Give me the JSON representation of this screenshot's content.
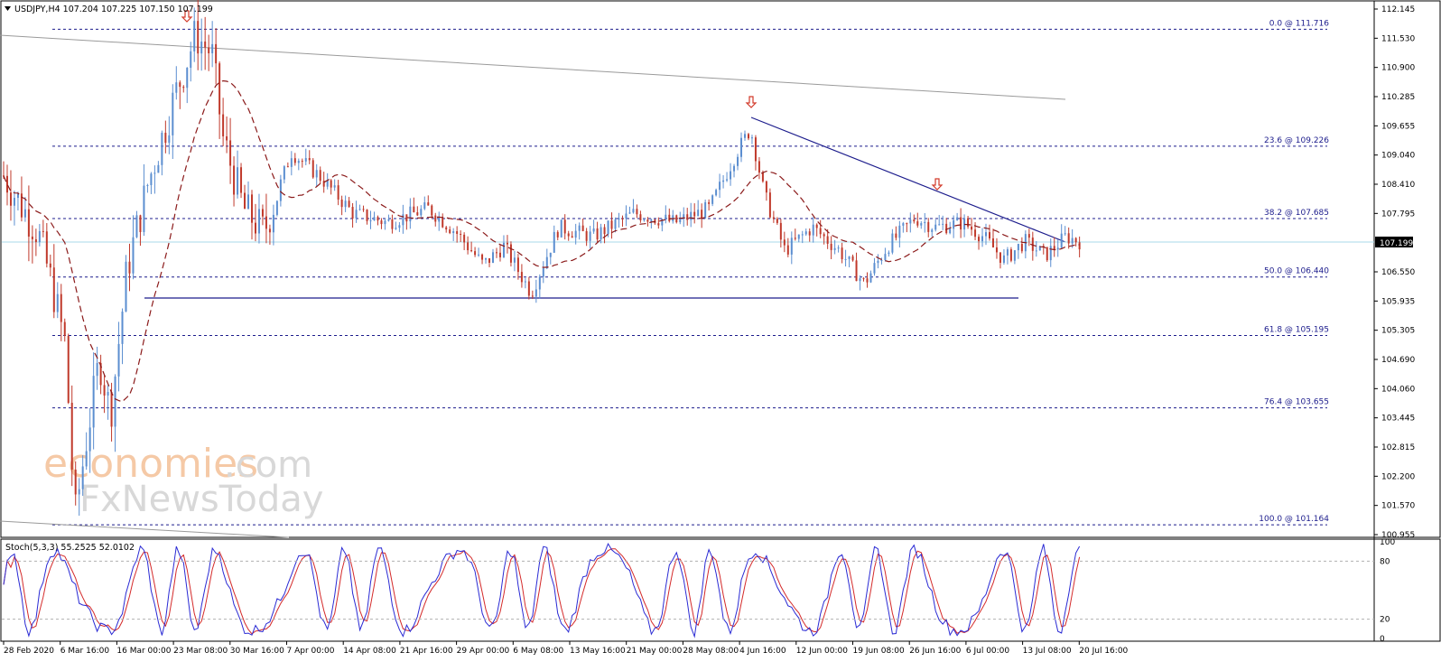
{
  "chart_data": {
    "type": "candlestick",
    "symbol_header": "USDJPY,H4  107.204 107.225 107.150 107.199",
    "current_price": "107.199",
    "price_axis": {
      "range": [
        100.955,
        112.145
      ],
      "ticks": [
        "112.145",
        "111.530",
        "110.900",
        "110.285",
        "109.655",
        "109.040",
        "108.410",
        "107.795",
        "107.199",
        "106.550",
        "105.935",
        "105.305",
        "104.690",
        "104.060",
        "103.445",
        "102.815",
        "102.200",
        "101.570",
        "100.955"
      ]
    },
    "fib_levels": [
      {
        "label": "0.0 @ 111.716",
        "price": 111.716
      },
      {
        "label": "23.6 @ 109.226",
        "price": 109.226
      },
      {
        "label": "38.2 @ 107.685",
        "price": 107.685
      },
      {
        "label": "50.0 @ 106.440",
        "price": 106.44
      },
      {
        "label": "61.8 @ 105.195",
        "price": 105.195
      },
      {
        "label": "76.4 @ 103.655",
        "price": 103.655
      },
      {
        "label": "100.0 @ 101.164",
        "price": 101.164
      }
    ],
    "time_axis": {
      "labels": [
        "28 Feb 2020",
        "6 Mar 16:00",
        "16 Mar 00:00",
        "23 Mar 08:00",
        "30 Mar 16:00",
        "7 Apr 00:00",
        "14 Apr 08:00",
        "21 Apr 16:00",
        "29 Apr 00:00",
        "6 May 08:00",
        "13 May 16:00",
        "21 May 00:00",
        "28 May 08:00",
        "4 Jun 16:00",
        "12 Jun 00:00",
        "19 Jun 08:00",
        "26 Jun 16:00",
        "6 Jul 00:00",
        "13 Jul 08:00",
        "20 Jul 16:00"
      ]
    },
    "price_path": [
      {
        "x": 0,
        "y": 108.6
      },
      {
        "x": 0.012,
        "y": 108.0
      },
      {
        "x": 0.025,
        "y": 107.4
      },
      {
        "x": 0.035,
        "y": 106.3
      },
      {
        "x": 0.045,
        "y": 105.0
      },
      {
        "x": 0.052,
        "y": 101.3
      },
      {
        "x": 0.06,
        "y": 102.9
      },
      {
        "x": 0.07,
        "y": 104.7
      },
      {
        "x": 0.078,
        "y": 103.5
      },
      {
        "x": 0.09,
        "y": 106.6
      },
      {
        "x": 0.105,
        "y": 108.4
      },
      {
        "x": 0.125,
        "y": 110.3
      },
      {
        "x": 0.14,
        "y": 111.6
      },
      {
        "x": 0.152,
        "y": 111.2
      },
      {
        "x": 0.16,
        "y": 109.4
      },
      {
        "x": 0.175,
        "y": 107.9
      },
      {
        "x": 0.19,
        "y": 107.4
      },
      {
        "x": 0.21,
        "y": 109.1
      },
      {
        "x": 0.23,
        "y": 108.6
      },
      {
        "x": 0.255,
        "y": 107.8
      },
      {
        "x": 0.28,
        "y": 107.6
      },
      {
        "x": 0.31,
        "y": 107.9
      },
      {
        "x": 0.33,
        "y": 107.4
      },
      {
        "x": 0.35,
        "y": 106.7
      },
      {
        "x": 0.365,
        "y": 107.1
      },
      {
        "x": 0.385,
        "y": 106.1
      },
      {
        "x": 0.405,
        "y": 107.5
      },
      {
        "x": 0.43,
        "y": 107.3
      },
      {
        "x": 0.46,
        "y": 107.8
      },
      {
        "x": 0.49,
        "y": 107.6
      },
      {
        "x": 0.515,
        "y": 107.9
      },
      {
        "x": 0.535,
        "y": 109.1
      },
      {
        "x": 0.545,
        "y": 109.6
      },
      {
        "x": 0.555,
        "y": 108.2
      },
      {
        "x": 0.57,
        "y": 107.0
      },
      {
        "x": 0.59,
        "y": 107.5
      },
      {
        "x": 0.61,
        "y": 107.0
      },
      {
        "x": 0.628,
        "y": 106.3
      },
      {
        "x": 0.645,
        "y": 107.1
      },
      {
        "x": 0.665,
        "y": 107.7
      },
      {
        "x": 0.68,
        "y": 107.5
      },
      {
        "x": 0.7,
        "y": 107.6
      },
      {
        "x": 0.715,
        "y": 107.3
      },
      {
        "x": 0.73,
        "y": 106.8
      },
      {
        "x": 0.745,
        "y": 107.2
      },
      {
        "x": 0.76,
        "y": 106.9
      },
      {
        "x": 0.775,
        "y": 107.3
      },
      {
        "x": 0.785,
        "y": 107.2
      }
    ],
    "stochastic": {
      "label": "Stoch(5,3,3) 55.2525 52.0102",
      "ticks": [
        "100",
        "80",
        "20",
        "0"
      ],
      "range": [
        0,
        100
      ]
    },
    "watermark": {
      "line1_a": "economies",
      "line1_b": ".com",
      "line2": "FxNewsToday"
    }
  }
}
